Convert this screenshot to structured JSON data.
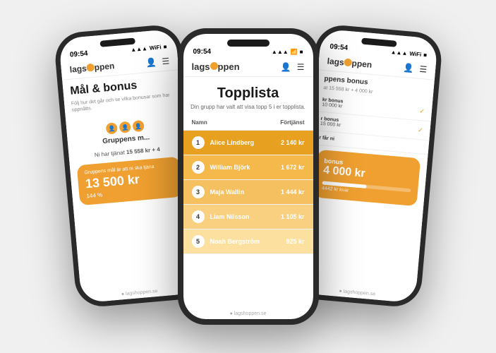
{
  "app": {
    "name": "lagshoppen",
    "footer": "lagshoppen.se",
    "logo_o_symbol": "O"
  },
  "center_phone": {
    "status": {
      "time": "09:54",
      "signal": "▲▲▲",
      "wifi": "WiFi",
      "battery": "■■■"
    },
    "header": {
      "logo": "lagshoppen",
      "person_icon": "👤",
      "menu_icon": "☰"
    },
    "title": "Topplista",
    "subtitle": "Din grupp har valt att visa topp 5 i er topplista.",
    "table": {
      "col_name": "Namn",
      "col_amount": "Förtjänst",
      "rows": [
        {
          "rank": "1",
          "name": "Alice Lindberg",
          "amount": "2 140 kr"
        },
        {
          "rank": "2",
          "name": "William Björk",
          "amount": "1 672 kr"
        },
        {
          "rank": "3",
          "name": "Maja Wallin",
          "amount": "1 444 kr"
        },
        {
          "rank": "4",
          "name": "Liam Nilsson",
          "amount": "1 105 kr"
        },
        {
          "rank": "5",
          "name": "Noah Bergström",
          "amount": "925 kr"
        }
      ]
    },
    "footer": "lagshoppen.se"
  },
  "left_phone": {
    "status": {
      "time": "09:54",
      "signal": "▲▲▲",
      "battery": "■■■"
    },
    "header": {
      "logo": "lagshoppen"
    },
    "title": "Mål & bonus",
    "subtitle": "Följ hur det går och se vilka bonusar som har uppnåtts.",
    "group_section": {
      "label": "Gruppens m...",
      "earned_text": "Ni har tjänat",
      "earned_amount": "15 558 kr + 4",
      "bonus_card": {
        "title": "Gruppens mål är att ni ska tjäna",
        "amount": "13 500 kr",
        "percent": "144 %"
      }
    }
  },
  "right_phone": {
    "status": {
      "time": "09:54",
      "signal": "▲▲▲",
      "battery": "■■■"
    },
    "header": {
      "logo": "lagshoppen"
    },
    "title": "ppens bonus",
    "subtitle": "at 15 558 kr + 4 000 kr",
    "bonus_items": [
      {
        "text": "kr bonus",
        "amount": "10 000 kr",
        "checked": true
      },
      {
        "text": "r bonus",
        "amount": "15 000 kr",
        "checked": true
      },
      {
        "text": "r får ni",
        "amount": "",
        "checked": false
      }
    ],
    "big_bonus": {
      "title": "bonus",
      "amount": "4 000 kr",
      "sub": "4442 kr kvar",
      "progress": 50
    }
  },
  "row_colors": {
    "gold": "#d4921c",
    "silver": "#e8a835",
    "bronze": "#f0b840",
    "rank4": "#f5c855",
    "rank5": "#f8d870"
  }
}
